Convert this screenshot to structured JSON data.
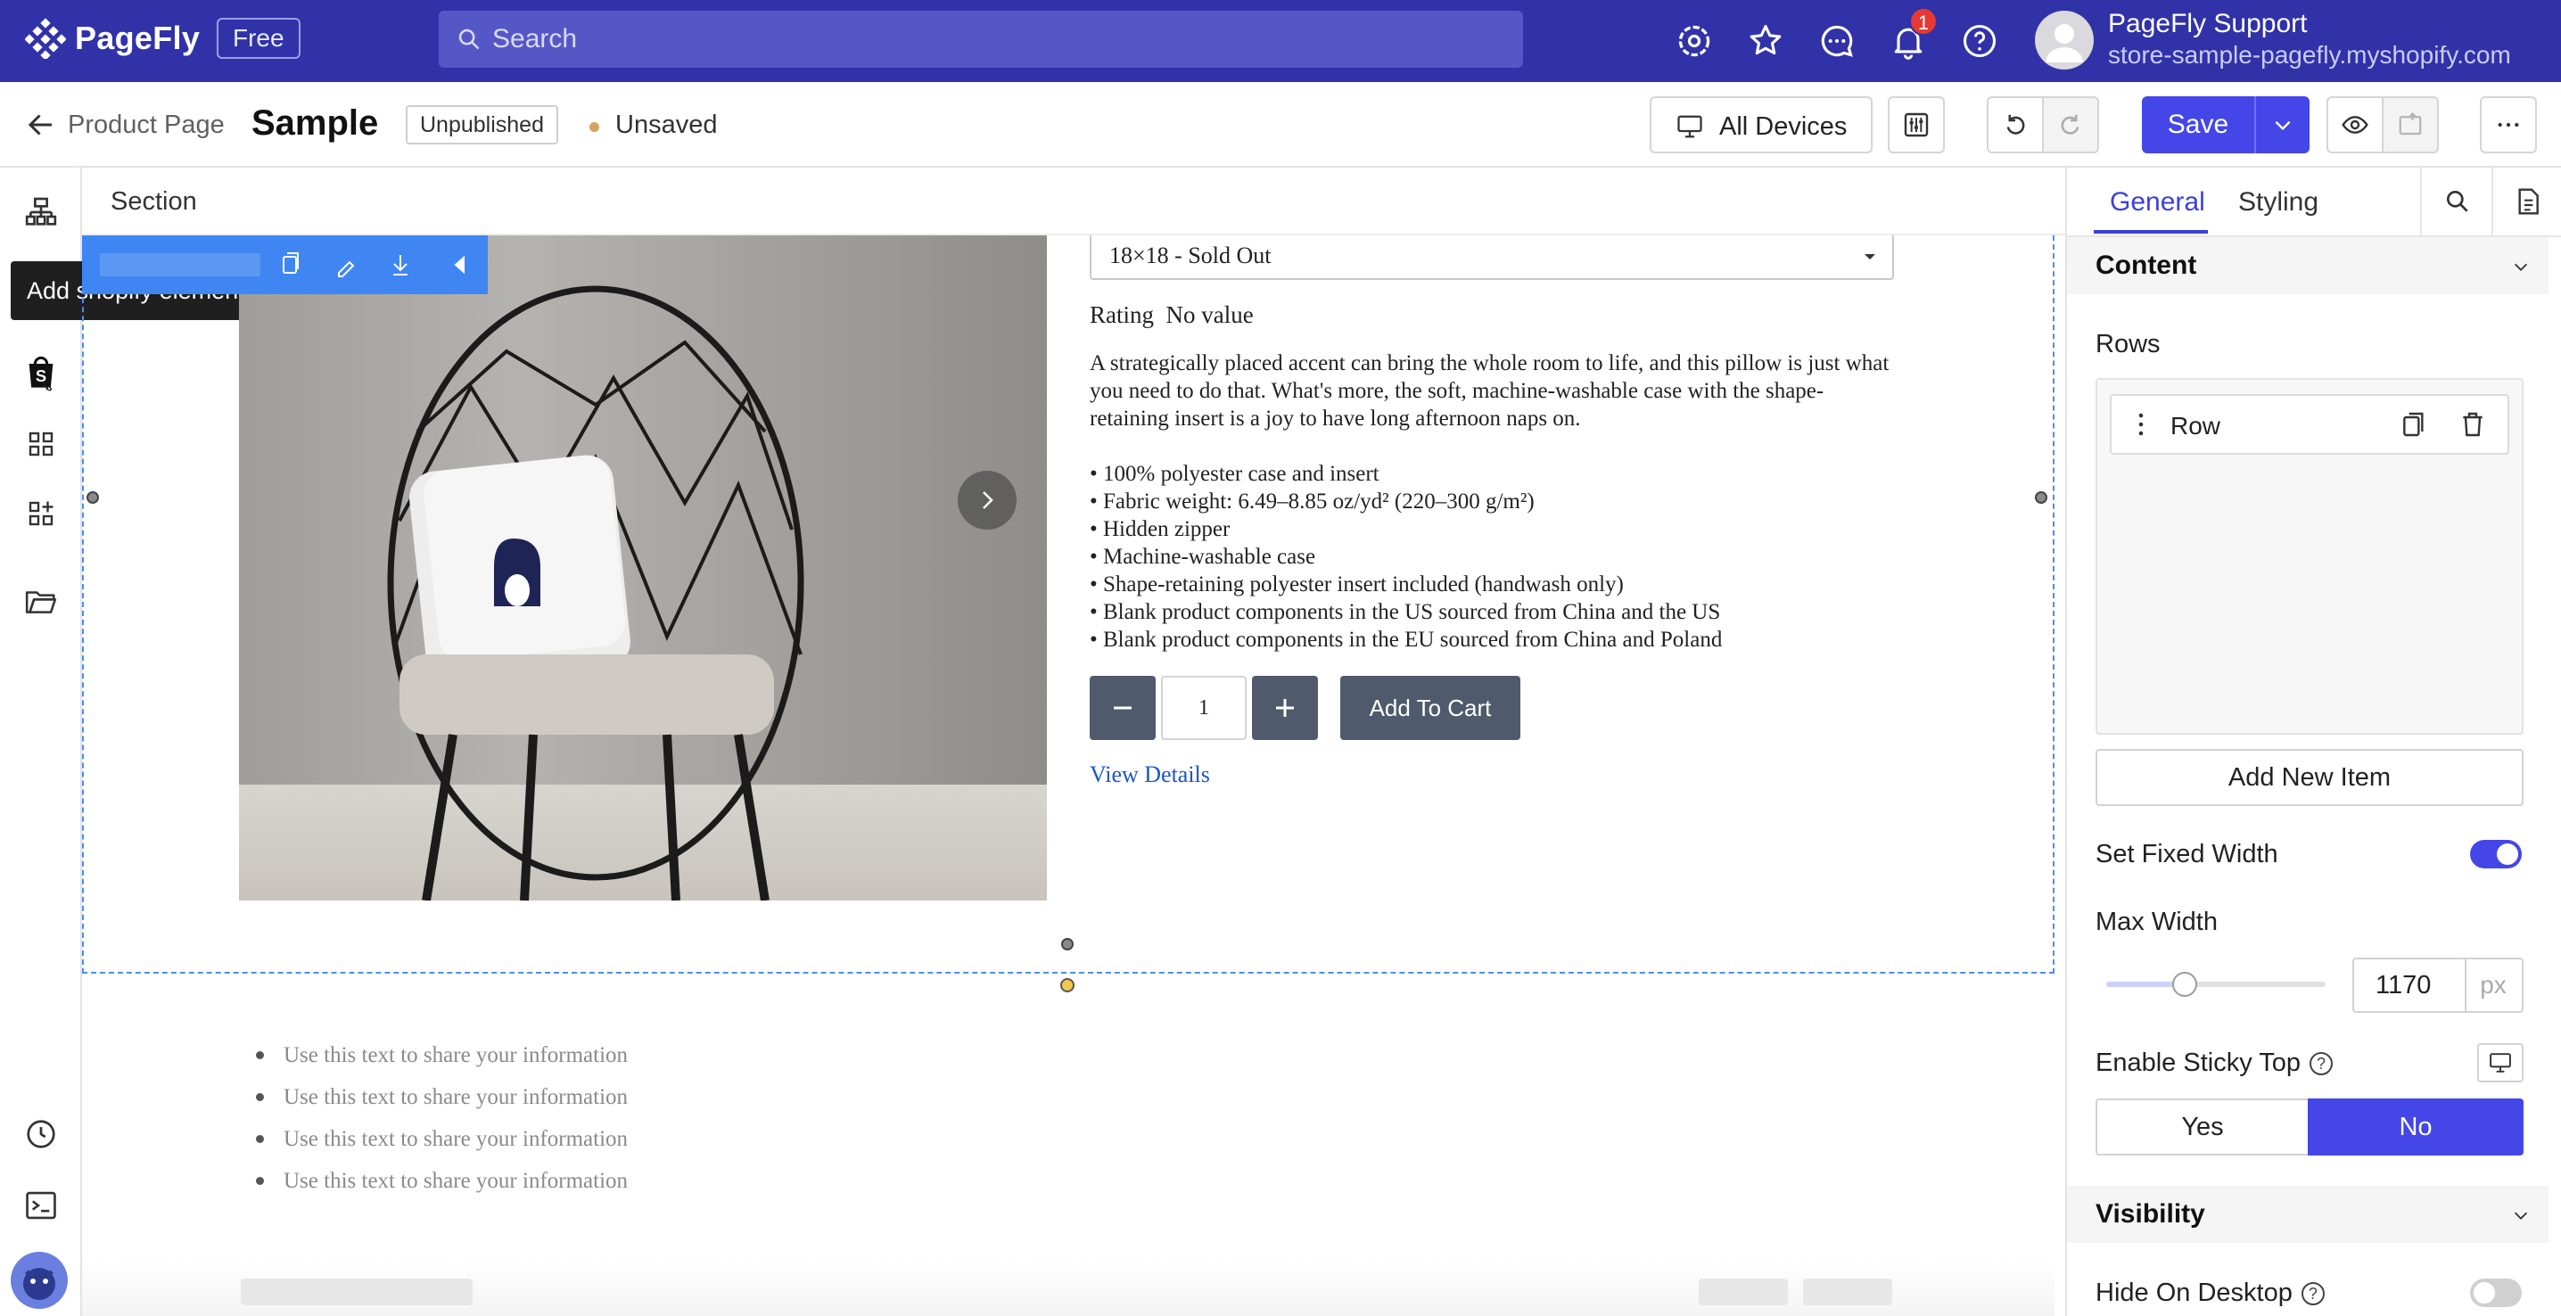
{
  "topbar": {
    "brand": "PageFly",
    "plan_badge": "Free",
    "search_placeholder": "Search",
    "notification_count": "1",
    "user_name": "PageFly Support",
    "store_url": "store-sample-pagefly.myshopify.com",
    "bg_color": "#3132a8"
  },
  "editorbar": {
    "breadcrumb": "Product Page",
    "page_title": "Sample",
    "status_badge": "Unpublished",
    "save_state": "Unsaved",
    "devices_label": "All Devices",
    "save_label": "Save"
  },
  "leftbar": {
    "tooltip": "Add shopify element",
    "icons": [
      "layers-icon",
      "shopify-bag-icon",
      "grid-icon",
      "add-grid-icon",
      "folder-icon",
      "history-icon",
      "terminal-icon",
      "avatar"
    ]
  },
  "canvas": {
    "section_label": "Section",
    "variant": "18×18 - Sold Out",
    "rating_label": "Rating",
    "rating_value": "No value",
    "description": "A strategically placed accent can bring the whole room to life, and this pillow is just what you need to do that. What's more, the soft, machine-washable case with the shape-retaining insert is a joy to have long afternoon naps on.",
    "features": [
      "• 100% polyester case and insert",
      "• Fabric weight: 6.49–8.85 oz/yd² (220–300 g/m²)",
      "• Hidden zipper",
      "• Machine-washable case",
      "• Shape-retaining polyester insert included (handwash only)",
      "• Blank product components in the US sourced from China and the US",
      "• Blank product components in the EU sourced from China and Poland"
    ],
    "quantity": "1",
    "add_to_cart": "Add To Cart",
    "view_details": "View Details",
    "text_list": [
      "Use this text to share your information",
      "Use this text to share your information",
      "Use this text to share your information",
      "Use this text to share your information"
    ]
  },
  "rightpanel": {
    "tabs": [
      "General",
      "Styling"
    ],
    "content_heading": "Content",
    "rows_label": "Rows",
    "row_item": "Row",
    "add_new_item": "Add New Item",
    "fixed_width_label": "Set Fixed Width",
    "fixed_width_on": true,
    "max_width_label": "Max Width",
    "max_width_value": "1170",
    "max_width_unit": "px",
    "sticky_label": "Enable Sticky Top",
    "sticky_yes": "Yes",
    "sticky_no": "No",
    "sticky_selected": "No",
    "visibility_heading": "Visibility",
    "hide_desktop_label": "Hide On Desktop",
    "hide_desktop_on": false,
    "accent_color": "#4446e8"
  }
}
